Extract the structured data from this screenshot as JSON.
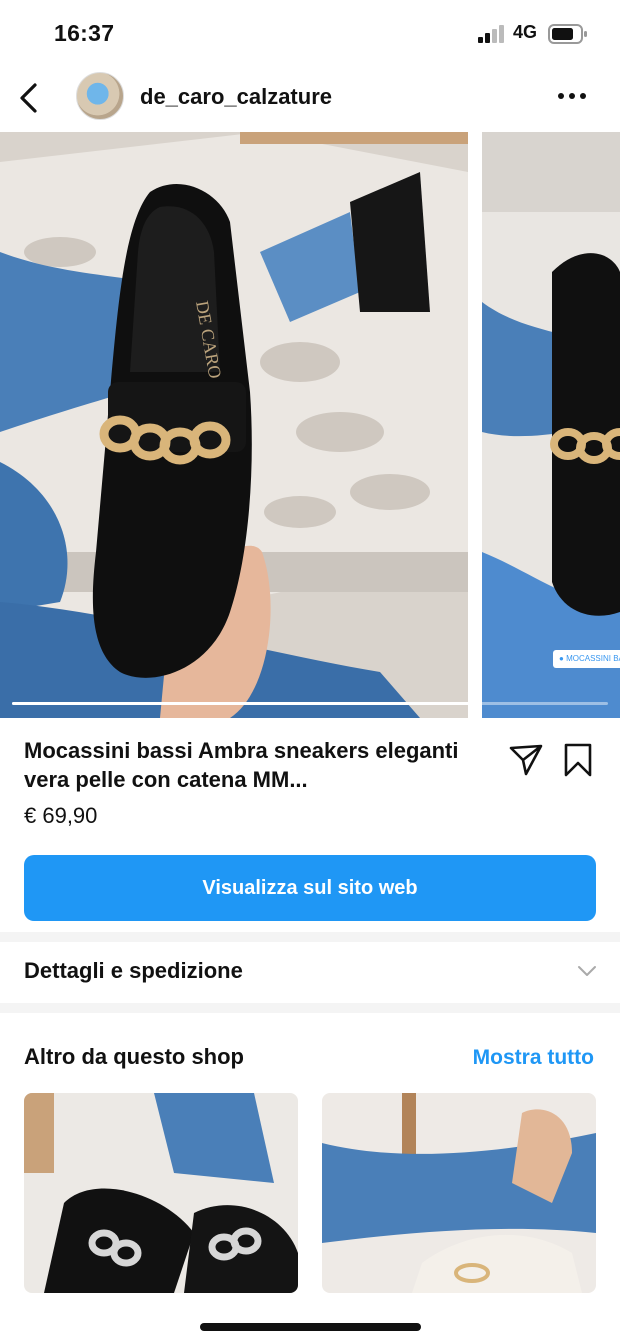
{
  "status": {
    "time": "16:37",
    "network": "4G"
  },
  "header": {
    "username": "de_caro_calzature"
  },
  "carousel": {
    "tag_label": "MOCASSINI BASSI",
    "progress_fraction": 0.77
  },
  "product": {
    "title": "Mocassini bassi Ambra sneakers eleganti vera pelle con catena MM...",
    "price": "€ 69,90",
    "cta_label": "Visualizza sul sito web"
  },
  "details": {
    "label": "Dettagli e spedizione"
  },
  "shop": {
    "heading": "Altro da questo shop",
    "show_all": "Mostra tutto"
  },
  "colors": {
    "accent": "#1f97f5",
    "background": "#ffffff"
  }
}
